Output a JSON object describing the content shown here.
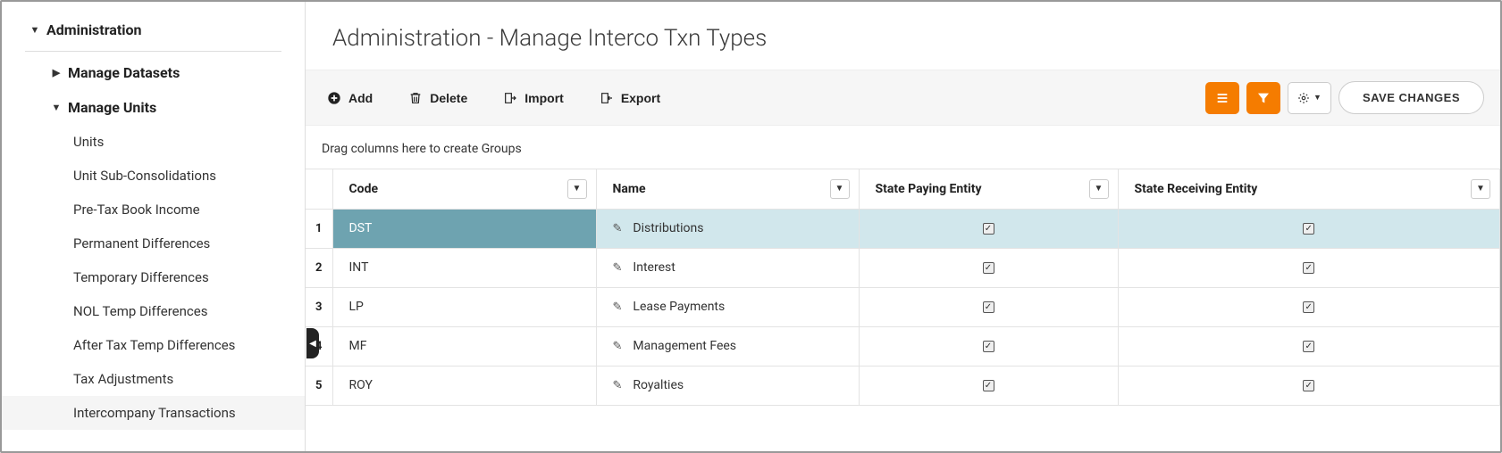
{
  "sidebar": {
    "root": {
      "label": "Administration",
      "expanded": true
    },
    "groups": [
      {
        "label": "Manage Datasets",
        "expanded": false
      },
      {
        "label": "Manage Units",
        "expanded": true,
        "items": [
          {
            "label": "Units"
          },
          {
            "label": "Unit Sub-Consolidations"
          },
          {
            "label": "Pre-Tax Book Income"
          },
          {
            "label": "Permanent Differences"
          },
          {
            "label": "Temporary Differences"
          },
          {
            "label": "NOL Temp Differences"
          },
          {
            "label": "After Tax Temp Differences"
          },
          {
            "label": "Tax Adjustments"
          },
          {
            "label": "Intercompany Transactions",
            "selected": true
          }
        ]
      }
    ]
  },
  "page": {
    "title": "Administration - Manage Interco Txn Types"
  },
  "toolbar": {
    "add": "Add",
    "delete": "Delete",
    "import": "Import",
    "export": "Export",
    "save": "SAVE CHANGES"
  },
  "groupbar": {
    "hint": "Drag columns here to create Groups"
  },
  "columns": {
    "code": "Code",
    "name": "Name",
    "spe": "State Paying Entity",
    "sre": "State Receiving Entity"
  },
  "rows": [
    {
      "n": "1",
      "code": "DST",
      "name": "Distributions",
      "spe": true,
      "sre": true,
      "selected": true
    },
    {
      "n": "2",
      "code": "INT",
      "name": "Interest",
      "spe": true,
      "sre": true
    },
    {
      "n": "3",
      "code": "LP",
      "name": "Lease Payments",
      "spe": true,
      "sre": true
    },
    {
      "n": "4",
      "code": "MF",
      "name": "Management Fees",
      "spe": true,
      "sre": true
    },
    {
      "n": "5",
      "code": "ROY",
      "name": "Royalties",
      "spe": true,
      "sre": true
    }
  ]
}
